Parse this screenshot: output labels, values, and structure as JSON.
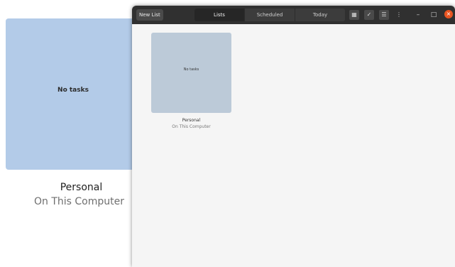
{
  "background_view": {
    "card_text": "No tasks",
    "list_name": "Personal",
    "list_source": "On This Computer"
  },
  "window": {
    "new_list_label": "New List",
    "tabs": [
      {
        "label": "Lists",
        "active": true
      },
      {
        "label": "Scheduled",
        "active": false
      },
      {
        "label": "Today",
        "active": false
      }
    ],
    "toolbar_icons": [
      "grid-icon",
      "checkmark-icon",
      "list-icon",
      "menu-icon"
    ],
    "window_controls": {
      "minimize": "–",
      "maximize": "□",
      "close": "×"
    },
    "lists": [
      {
        "card_text": "No tasks",
        "name": "Personal",
        "source": "On This Computer"
      }
    ]
  },
  "colors": {
    "headerbar": "#303030",
    "card_bg_large": "#b3cbe8",
    "card_bg_small": "#bccad8",
    "close_button": "#e95420"
  }
}
